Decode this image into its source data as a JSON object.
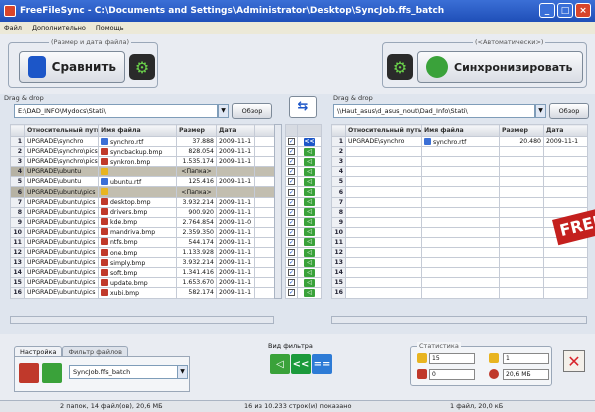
{
  "window": {
    "title": "FreeFileSync - C:\\Documents and Settings\\Administrator\\Desktop\\SyncJob.ffs_batch"
  },
  "menu": [
    "Файл",
    "Дополнительно",
    "Помощь"
  ],
  "compare": {
    "group_label": "(Размер и дата файла)",
    "button_label": "Сравнить"
  },
  "sync": {
    "group_label": "(<Автоматически>)",
    "button_label": "Синхронизировать"
  },
  "left": {
    "dragdrop": "Drag & drop",
    "path": "E:\\DAD_INFO\\Mydocs\\Stati\\",
    "browse_label": "Обзор",
    "columns": [
      "Относительный путь",
      "Имя файла",
      "Размер",
      "Дата"
    ],
    "rows": [
      {
        "n": "1",
        "path": "UPGRADE\\synchro",
        "name": "synchro.rtf",
        "size": "37.888",
        "date": "2009-11-1",
        "icon": "rtf",
        "dir": false
      },
      {
        "n": "2",
        "path": "UPGRADE\\synchro\\pics",
        "name": "syncbackup.bmp",
        "size": "828.054",
        "date": "2009-11-1",
        "icon": "img",
        "dir": false
      },
      {
        "n": "3",
        "path": "UPGRADE\\synchro\\pics",
        "name": "synkron.bmp",
        "size": "1.535.174",
        "date": "2009-11-1",
        "icon": "img",
        "dir": false
      },
      {
        "n": "4",
        "path": "UPGRADE\\ubuntu",
        "name": "",
        "size": "<Папка>",
        "date": "",
        "icon": "dir",
        "dir": true
      },
      {
        "n": "5",
        "path": "UPGRADE\\ubuntu",
        "name": "ubuntu.rtf",
        "size": "125.416",
        "date": "2009-11-1",
        "icon": "rtf",
        "dir": false
      },
      {
        "n": "6",
        "path": "UPGRADE\\ubuntu\\pics",
        "name": "",
        "size": "<Папка>",
        "date": "",
        "icon": "dir",
        "dir": true
      },
      {
        "n": "7",
        "path": "UPGRADE\\ubuntu\\pics",
        "name": "desktop.bmp",
        "size": "3.932.214",
        "date": "2009-11-1",
        "icon": "img",
        "dir": false
      },
      {
        "n": "8",
        "path": "UPGRADE\\ubuntu\\pics",
        "name": "drivers.bmp",
        "size": "900.920",
        "date": "2009-11-1",
        "icon": "img",
        "dir": false
      },
      {
        "n": "9",
        "path": "UPGRADE\\ubuntu\\pics",
        "name": "kde.bmp",
        "size": "2.764.854",
        "date": "2009-11-0",
        "icon": "img",
        "dir": false
      },
      {
        "n": "10",
        "path": "UPGRADE\\ubuntu\\pics",
        "name": "mandriva.bmp",
        "size": "2.359.350",
        "date": "2009-11-1",
        "icon": "img",
        "dir": false
      },
      {
        "n": "11",
        "path": "UPGRADE\\ubuntu\\pics",
        "name": "ntfs.bmp",
        "size": "544.174",
        "date": "2009-11-1",
        "icon": "img",
        "dir": false
      },
      {
        "n": "12",
        "path": "UPGRADE\\ubuntu\\pics",
        "name": "one.bmp",
        "size": "1.133.928",
        "date": "2009-11-1",
        "icon": "img",
        "dir": false
      },
      {
        "n": "13",
        "path": "UPGRADE\\ubuntu\\pics",
        "name": "simply.bmp",
        "size": "3.932.214",
        "date": "2009-11-1",
        "icon": "img",
        "dir": false
      },
      {
        "n": "14",
        "path": "UPGRADE\\ubuntu\\pics",
        "name": "soft.bmp",
        "size": "1.341.416",
        "date": "2009-11-1",
        "icon": "img",
        "dir": false
      },
      {
        "n": "15",
        "path": "UPGRADE\\ubuntu\\pics",
        "name": "update.bmp",
        "size": "1.653.670",
        "date": "2009-11-1",
        "icon": "img",
        "dir": false
      },
      {
        "n": "16",
        "path": "UPGRADE\\ubuntu\\pics",
        "name": "xubi.bmp",
        "size": "582.174",
        "date": "2009-11-1",
        "icon": "img",
        "dir": false
      }
    ]
  },
  "right": {
    "dragdrop": "Drag & drop",
    "path": "\\\\Haut_asus\\d_asus_nout\\Dad_Info\\Stati\\",
    "browse_label": "Обзор",
    "columns": [
      "Относительный путь",
      "Имя файла",
      "Размер",
      "Дата"
    ],
    "rows": [
      {
        "n": "1",
        "path": "UPGRADE\\synchro",
        "name": "synchro.rtf",
        "size": "20.480",
        "date": "2009-11-1",
        "icon": "rtf"
      },
      {
        "n": "2"
      },
      {
        "n": "3"
      },
      {
        "n": "4"
      },
      {
        "n": "5"
      },
      {
        "n": "6"
      },
      {
        "n": "7"
      },
      {
        "n": "8"
      },
      {
        "n": "9"
      },
      {
        "n": "10"
      },
      {
        "n": "11"
      },
      {
        "n": "12"
      },
      {
        "n": "13"
      },
      {
        "n": "14"
      },
      {
        "n": "15"
      },
      {
        "n": "16"
      }
    ]
  },
  "bottom": {
    "tabs": [
      "Настройка",
      "Фильтр файлов"
    ],
    "batch_name": "SyncJob.ffs_batch",
    "view_filter_label": "Вид фильтра",
    "stats_label": "Статистика",
    "stats": {
      "create": "15",
      "delete": "0",
      "overwrite": "1",
      "data": "20,6 MБ"
    }
  },
  "status": {
    "left": "2 папок, 14 файл(ов), 20,6 MБ",
    "middle": "16 из 10.233 строк(и) показано",
    "right": "1 файл, 20,0 кБ"
  },
  "badge": "FREE",
  "colors": {
    "accent": "#1c56c8",
    "title_bar": "#2a5cc4",
    "green": "#3aa23a",
    "badge_red": "#c4201e"
  }
}
